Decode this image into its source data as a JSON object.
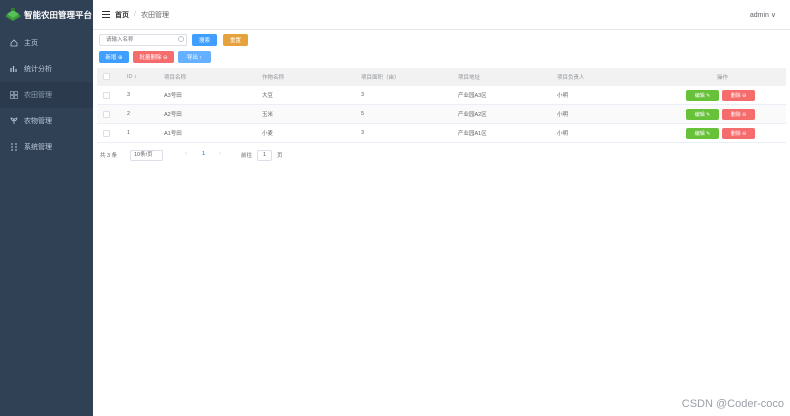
{
  "app": {
    "title": "智能农田管理平台"
  },
  "sidebar": {
    "items": [
      {
        "label": "主页",
        "icon": "home-icon"
      },
      {
        "label": "统计分析",
        "icon": "bar-chart-icon"
      },
      {
        "label": "农田管理",
        "icon": "grid-icon",
        "active": true
      },
      {
        "label": "农物管理",
        "icon": "plant-icon"
      },
      {
        "label": "系统管理",
        "icon": "settings-grid-icon"
      }
    ]
  },
  "header": {
    "home": "首页",
    "separator": "/",
    "current": "农田管理",
    "user": "admin ∨"
  },
  "toolbar": {
    "search_placeholder": "请输入名称",
    "search_label": "搜索",
    "reset_label": "重置",
    "add_label": "新增 ⊕",
    "batch_delete_label": "批量删除 ⊖",
    "export_label": "导出 ↑"
  },
  "table": {
    "headers": [
      "ID ↕",
      "项目名称",
      "作物名称",
      "项目面积（亩）",
      "项目地址",
      "项目负责人",
      "操作"
    ],
    "rows": [
      {
        "id": "3",
        "name": "A3号田",
        "crop": "大豆",
        "area": "3",
        "address": "产业园A3区",
        "owner": "小明"
      },
      {
        "id": "2",
        "name": "A2号田",
        "crop": "玉米",
        "area": "5",
        "address": "产业园A2区",
        "owner": "小明"
      },
      {
        "id": "1",
        "name": "A1号田",
        "crop": "小麦",
        "area": "3",
        "address": "产业园A1区",
        "owner": "小明"
      }
    ],
    "edit_label": "编辑 ✎",
    "delete_label": "删除 ⊖"
  },
  "pagination": {
    "total": "共 3 条",
    "page_size": "10条/页",
    "prev": "‹",
    "current_page": "1",
    "next": "›",
    "goto_prefix": "前往",
    "goto_value": "1",
    "goto_suffix": "页"
  },
  "watermark": "CSDN @Coder-coco",
  "colors": {
    "sidebar": "#304156",
    "primary": "#409eff",
    "success": "#67c23a",
    "danger": "#f56c6c",
    "warning": "#e6a23c"
  }
}
